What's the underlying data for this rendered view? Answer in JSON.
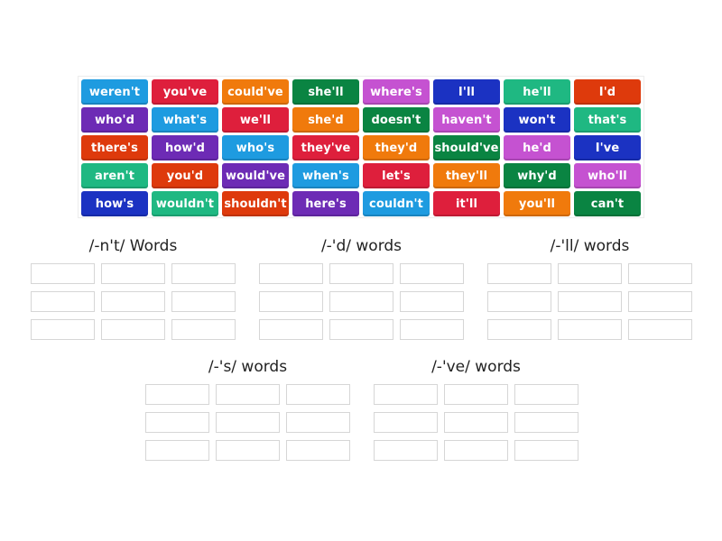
{
  "tiles": [
    {
      "label": "weren't",
      "color": "#1e9be0"
    },
    {
      "label": "you've",
      "color": "#de1f3c"
    },
    {
      "label": "could've",
      "color": "#f07a0c"
    },
    {
      "label": "she'll",
      "color": "#0a8442"
    },
    {
      "label": "where's",
      "color": "#c552d1"
    },
    {
      "label": "I'll",
      "color": "#1b32c2"
    },
    {
      "label": "he'll",
      "color": "#1fb882"
    },
    {
      "label": "I'd",
      "color": "#de3a0c"
    },
    {
      "label": "who'd",
      "color": "#6d2bb5"
    },
    {
      "label": "what's",
      "color": "#1e9be0"
    },
    {
      "label": "we'll",
      "color": "#de1f3c"
    },
    {
      "label": "she'd",
      "color": "#f07a0c"
    },
    {
      "label": "doesn't",
      "color": "#0a8442"
    },
    {
      "label": "haven't",
      "color": "#c552d1"
    },
    {
      "label": "won't",
      "color": "#1b32c2"
    },
    {
      "label": "that's",
      "color": "#1fb882"
    },
    {
      "label": "there's",
      "color": "#de3a0c"
    },
    {
      "label": "how'd",
      "color": "#6d2bb5"
    },
    {
      "label": "who's",
      "color": "#1e9be0"
    },
    {
      "label": "they've",
      "color": "#de1f3c"
    },
    {
      "label": "they'd",
      "color": "#f07a0c"
    },
    {
      "label": "should've",
      "color": "#0a8442"
    },
    {
      "label": "he'd",
      "color": "#c552d1"
    },
    {
      "label": "I've",
      "color": "#1b32c2"
    },
    {
      "label": "aren't",
      "color": "#1fb882"
    },
    {
      "label": "you'd",
      "color": "#de3a0c"
    },
    {
      "label": "would've",
      "color": "#6d2bb5"
    },
    {
      "label": "when's",
      "color": "#1e9be0"
    },
    {
      "label": "let's",
      "color": "#de1f3c"
    },
    {
      "label": "they'll",
      "color": "#f07a0c"
    },
    {
      "label": "why'd",
      "color": "#0a8442"
    },
    {
      "label": "who'll",
      "color": "#c552d1"
    },
    {
      "label": "how's",
      "color": "#1b32c2"
    },
    {
      "label": "wouldn't",
      "color": "#1fb882"
    },
    {
      "label": "shouldn't",
      "color": "#de3a0c"
    },
    {
      "label": "here's",
      "color": "#6d2bb5"
    },
    {
      "label": "couldn't",
      "color": "#1e9be0"
    },
    {
      "label": "it'll",
      "color": "#de1f3c"
    },
    {
      "label": "you'll",
      "color": "#f07a0c"
    },
    {
      "label": "can't",
      "color": "#0a8442"
    }
  ],
  "groups": [
    {
      "title": "/-n't/ Words",
      "slots": 9
    },
    {
      "title": "/-'d/ words",
      "slots": 9
    },
    {
      "title": "/-'ll/ words",
      "slots": 9
    },
    {
      "title": "/-'s/ words",
      "slots": 9
    },
    {
      "title": "/-'ve/ words",
      "slots": 9
    }
  ]
}
